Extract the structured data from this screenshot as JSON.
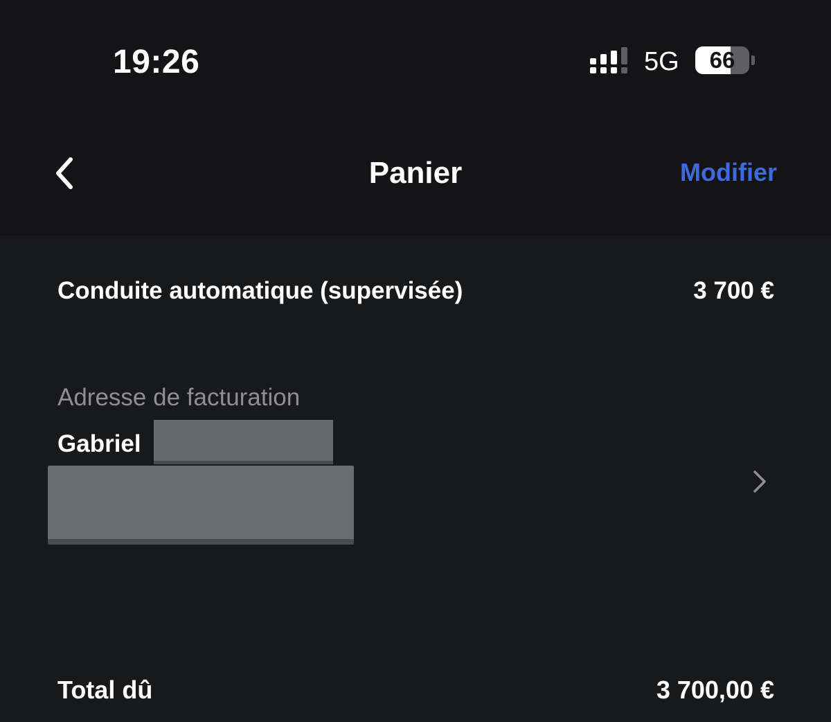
{
  "status_bar": {
    "time": "19:26",
    "network": "5G",
    "battery_level": "66",
    "battery_fraction": 0.66,
    "signal_icon": "signal-bars-icon"
  },
  "nav": {
    "title": "Panier",
    "edit_label": "Modifier",
    "back_icon": "chevron-left-icon"
  },
  "colors": {
    "background": "#18191b",
    "accent": "#3e6ae1",
    "secondary_text": "#8e8e93"
  },
  "cart": {
    "item_name": "Conduite automatique (supervisée)",
    "item_price": "3 700 €"
  },
  "billing": {
    "label": "Adresse de facturation",
    "first_name": "Gabriel",
    "chevron_icon": "chevron-right-icon"
  },
  "total": {
    "label": "Total dû",
    "amount": "3 700,00 €"
  }
}
